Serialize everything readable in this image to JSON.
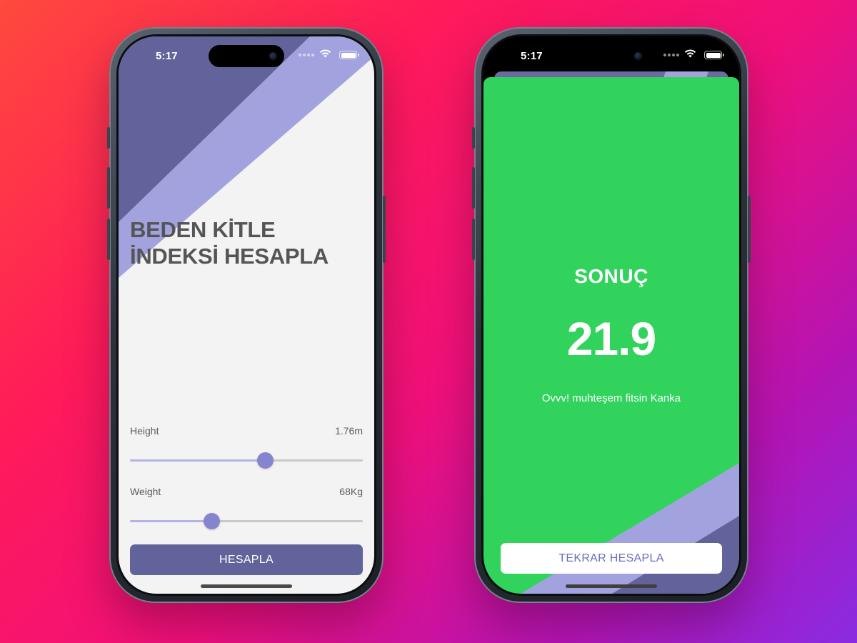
{
  "left_phone": {
    "status_time": "5:17",
    "title_line1": "BEDEN KİTLE",
    "title_line2": "İNDEKSİ HESAPLA",
    "height": {
      "label": "Height",
      "value": "1.76m",
      "level": 0.58
    },
    "weight": {
      "label": "Weight",
      "value": "68Kg",
      "level": 0.35
    },
    "calculate_button": "HESAPLA"
  },
  "right_phone": {
    "status_time": "5:17",
    "result_heading": "SONUÇ",
    "result_value": "21.9",
    "result_message": "Ovvv! muhteşem fitsin Kanka",
    "recalculate_button": "TEKRAR HESAPLA"
  },
  "colors": {
    "primary": "#62639a",
    "primary_light": "#a2a3de",
    "result_green": "#31d35d",
    "screen_bg": "#f3f3f3"
  },
  "icons": [
    "wifi-icon",
    "battery-icon",
    "cellular-dots-icon"
  ]
}
